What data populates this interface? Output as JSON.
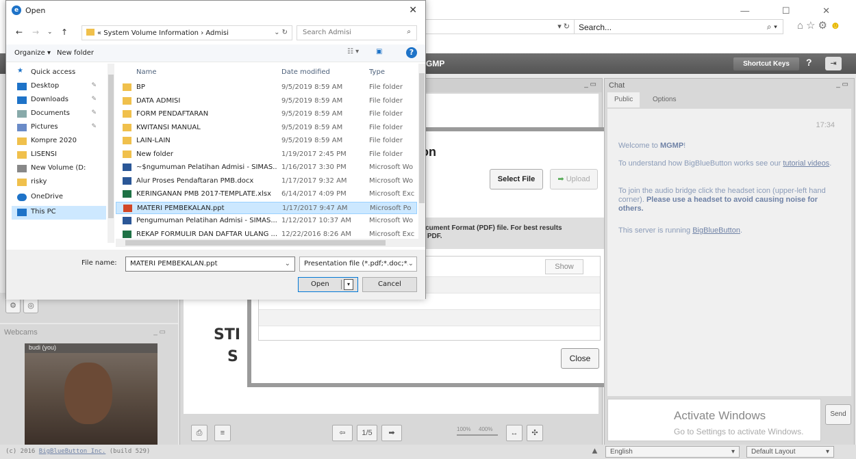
{
  "browser": {
    "search_placeholder": "Search...",
    "addr_controls": "▾ ↻",
    "window_controls": "— ☐ ✕",
    "search_dropdown": "⌕ ▾",
    "icons": [
      "home-icon",
      "star-icon",
      "gear-icon",
      "smiley-icon"
    ]
  },
  "app": {
    "title": "MGMP",
    "shortcut_keys": "Shortcut Keys",
    "help": "?",
    "footer_copy": "(c) 2016 ",
    "footer_link": "BigBlueButton Inc.",
    "footer_build": " (build 529)",
    "language": "English",
    "layout": "Default Layout"
  },
  "presentation": {
    "slide_line1": "STI",
    "slide_line2": "S",
    "page_indicator": "1/5",
    "zoom_min": "100%",
    "zoom_max": "400%"
  },
  "upload_dialog": {
    "heading_fragment": "on",
    "select_file": "Select File",
    "upload": "Upload",
    "note_line1": "ocument Format (PDF) file.  For best results",
    "note_line2": "d PDF.",
    "show": "Show",
    "close": "Close"
  },
  "chat": {
    "title": "Chat",
    "tabs": [
      "Public",
      "Options"
    ],
    "time": "17:34",
    "welcome_prefix": "Welcome to ",
    "welcome_name": "MGMP",
    "welcome_suffix": "!",
    "understand_prefix": "To understand how BigBlueButton works see our ",
    "understand_link": "tutorial videos",
    "understand_suffix": ".",
    "audio_prefix": "To join the audio bridge click the headset icon (upper-left hand corner). ",
    "audio_bold": "Please use a headset to avoid causing noise for others.",
    "server_prefix": "This server is running ",
    "server_link": "BigBlueButton",
    "server_suffix": ".",
    "send": "Send",
    "activate_title": "Activate Windows",
    "activate_sub": "Go to Settings to activate Windows."
  },
  "webcams": {
    "title": "Webcams",
    "label": "budi (you)"
  },
  "open_dialog": {
    "title": "Open",
    "path": "« System Volume Information  ›  Admisi",
    "search_placeholder": "Search Admisi",
    "organize": "Organize ▾",
    "new_folder": "New folder",
    "columns": {
      "name": "Name",
      "date": "Date modified",
      "type": "Type"
    },
    "nav_items": [
      {
        "label": "Quick access",
        "icon": "star-icon"
      },
      {
        "label": "Desktop",
        "icon": "desktop-icon"
      },
      {
        "label": "Downloads",
        "icon": "download-icon"
      },
      {
        "label": "Documents",
        "icon": "documents-icon"
      },
      {
        "label": "Pictures",
        "icon": "pictures-icon"
      },
      {
        "label": "Kompre 2020",
        "icon": "folder-icon"
      },
      {
        "label": "LISENSI",
        "icon": "folder-icon"
      },
      {
        "label": "New Volume (D:",
        "icon": "drive-icon"
      },
      {
        "label": "risky",
        "icon": "folder-icon"
      },
      {
        "label": "OneDrive",
        "icon": "cloud-icon"
      },
      {
        "label": "This PC",
        "icon": "pc-icon"
      }
    ],
    "files": [
      {
        "name": "BP",
        "date": "9/5/2019 8:59 AM",
        "type": "File folder",
        "icon": "folder"
      },
      {
        "name": "DATA ADMISI",
        "date": "9/5/2019 8:59 AM",
        "type": "File folder",
        "icon": "folder"
      },
      {
        "name": "FORM PENDAFTARAN",
        "date": "9/5/2019 8:59 AM",
        "type": "File folder",
        "icon": "folder"
      },
      {
        "name": "KWITANSI MANUAL",
        "date": "9/5/2019 8:59 AM",
        "type": "File folder",
        "icon": "folder"
      },
      {
        "name": "LAIN-LAIN",
        "date": "9/5/2019 8:59 AM",
        "type": "File folder",
        "icon": "folder"
      },
      {
        "name": "New folder",
        "date": "1/19/2017 2:45 PM",
        "type": "File folder",
        "icon": "folder"
      },
      {
        "name": "~$ngumuman Pelatihan Admisi - SIMAS....",
        "date": "1/16/2017 3:30 PM",
        "type": "Microsoft Wo",
        "icon": "word"
      },
      {
        "name": "Alur Proses Pendaftaran PMB.docx",
        "date": "1/17/2017 9:32 AM",
        "type": "Microsoft Wo",
        "icon": "word"
      },
      {
        "name": "KERINGANAN PMB 2017-TEMPLATE.xlsx",
        "date": "6/14/2017 4:09 PM",
        "type": "Microsoft Exc",
        "icon": "excel"
      },
      {
        "name": "MATERI PEMBEKALAN.ppt",
        "date": "1/17/2017 9:47 AM",
        "type": "Microsoft Po",
        "icon": "ppt"
      },
      {
        "name": "Pengumuman Pelatihan Admisi - SIMAS....",
        "date": "1/12/2017 10:37 AM",
        "type": "Microsoft Wo",
        "icon": "word"
      },
      {
        "name": "REKAP FORMULIR DAN DAFTAR ULANG ...",
        "date": "12/22/2016 8:26 AM",
        "type": "Microsoft Exc",
        "icon": "excel"
      }
    ],
    "selected_index": 9,
    "file_name_label": "File name:",
    "file_name_value": "MATERI PEMBEKALAN.ppt",
    "file_type": "Presentation file (*.pdf;*.doc;*.c",
    "open": "Open",
    "cancel": "Cancel"
  },
  "colors": {
    "accent": "#1e73c8",
    "selection": "#cce8ff",
    "folder": "#f0c04c",
    "word": "#2b5797",
    "excel": "#1e7145",
    "ppt": "#d24726"
  }
}
